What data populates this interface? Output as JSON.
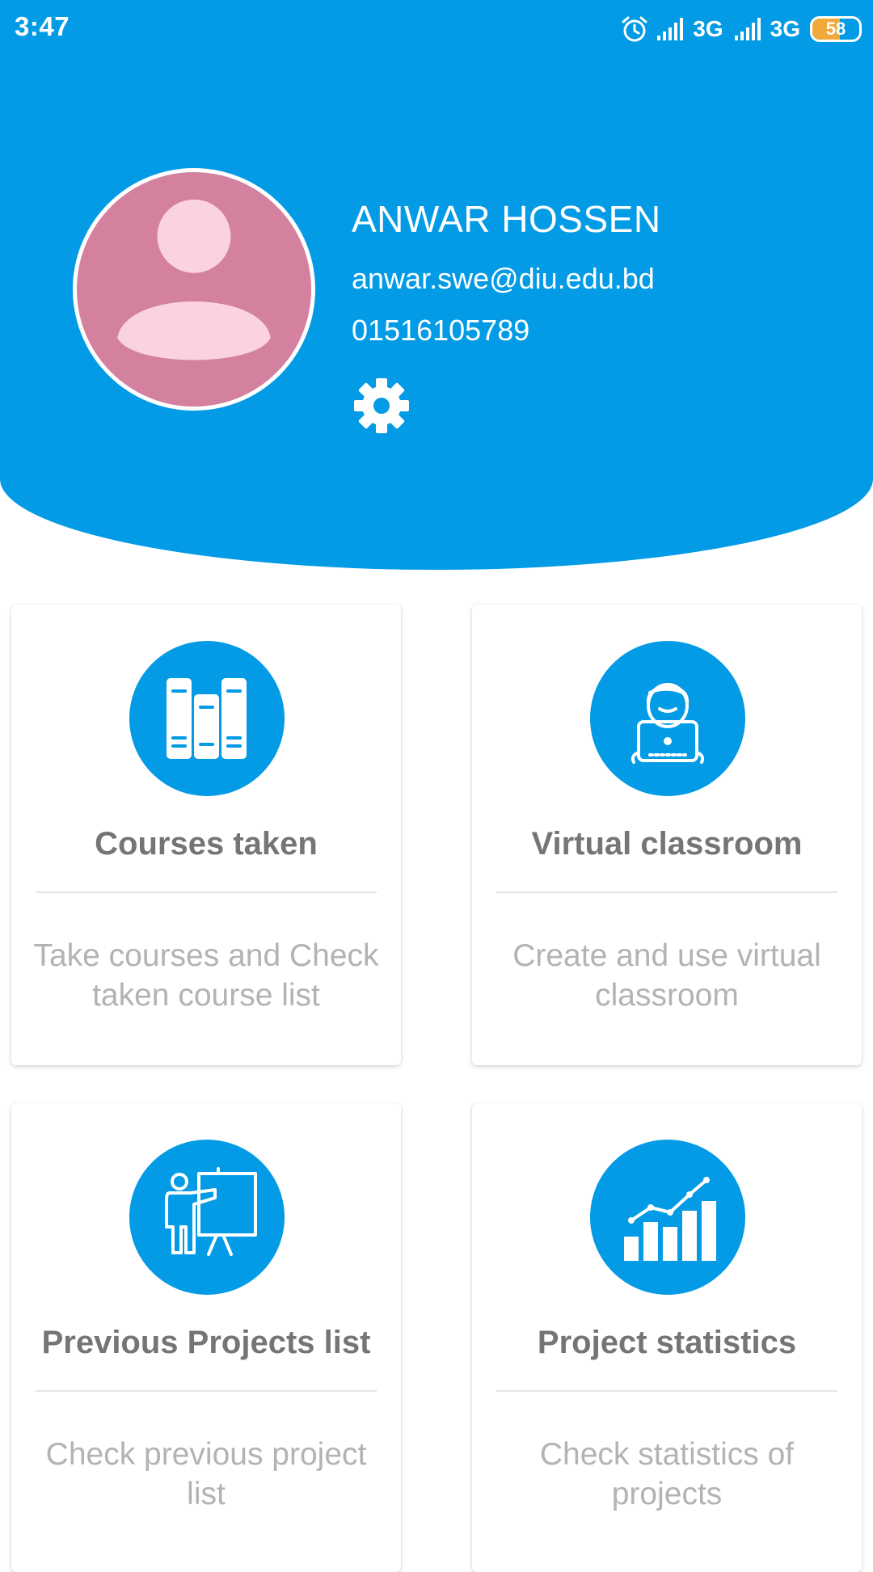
{
  "status_bar": {
    "time": "3:47",
    "network_1": "3G",
    "network_2": "3G",
    "battery": "58",
    "battery_level": 0.58,
    "icons": [
      "alarm-icon",
      "signal-icon",
      "signal-icon",
      "battery-icon"
    ]
  },
  "profile": {
    "name": "ANWAR HOSSEN",
    "email": "anwar.swe@diu.edu.bd",
    "phone": "01516105789",
    "avatar_icon": "user-avatar-icon",
    "settings_icon": "gear-icon"
  },
  "colors": {
    "primary": "#039be5",
    "avatar_bg": "#d3819f",
    "avatar_fg": "#fad3df",
    "battery": "#f2a93b",
    "card_title": "#757575",
    "card_desc": "#b3b3b3"
  },
  "cards": [
    {
      "title": "Courses taken",
      "description": "Take courses and Check taken course list",
      "icon": "books-icon"
    },
    {
      "title": "Virtual classroom",
      "description": "Create and use virtual classroom",
      "icon": "student-laptop-icon"
    },
    {
      "title": "Previous Projects list",
      "description": "Check previous project list",
      "icon": "presentation-icon"
    },
    {
      "title": "Project statistics",
      "description": "Check statistics of projects",
      "icon": "bar-chart-icon"
    }
  ]
}
